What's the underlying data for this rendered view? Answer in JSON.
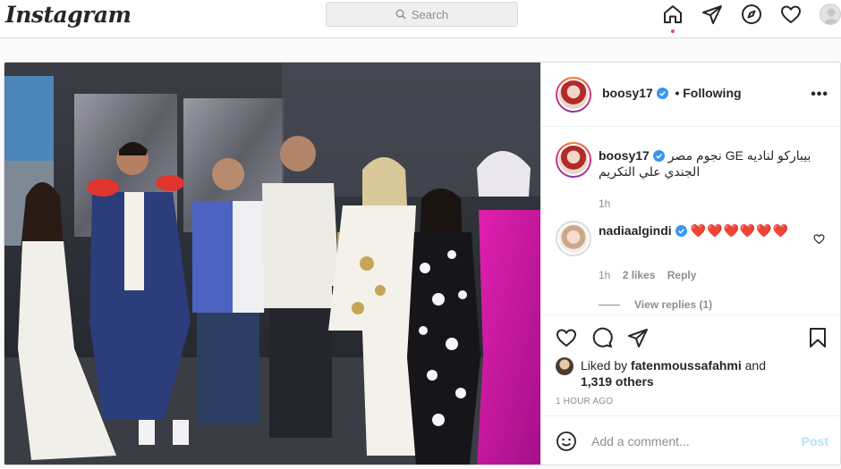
{
  "nav": {
    "logo": "Instagram",
    "search_placeholder": "Search",
    "icons": [
      "home-icon",
      "direct-icon",
      "explore-icon",
      "activity-icon",
      "profile-avatar"
    ]
  },
  "post": {
    "author": "boosy17",
    "author_verified": true,
    "follow_status": "• Following",
    "more_label": "•••",
    "caption": {
      "username": "boosy17",
      "text": "بيباركو لناديه GE نجوم مصر الجندي علي التكريم",
      "time": "1h"
    },
    "comments": [
      {
        "username": "nadiaalgindi",
        "verified": true,
        "text": "❤️❤️❤️❤️❤️❤️",
        "time": "1h",
        "likes": "2 likes",
        "reply_label": "Reply"
      }
    ],
    "view_replies": "View replies (1)",
    "liked_by": {
      "prefix": "Liked by",
      "user": "fatenmoussafahmi",
      "and": "and",
      "others": "1,319 others"
    },
    "time_ago": "1 HOUR AGO",
    "add_comment_placeholder": "Add a comment...",
    "post_label": "Post"
  },
  "colors": {
    "verified": "#3897f0",
    "heart_red": "#ed4956",
    "post_button_disabled": "#b2dffc",
    "border": "#dbdbdb"
  }
}
